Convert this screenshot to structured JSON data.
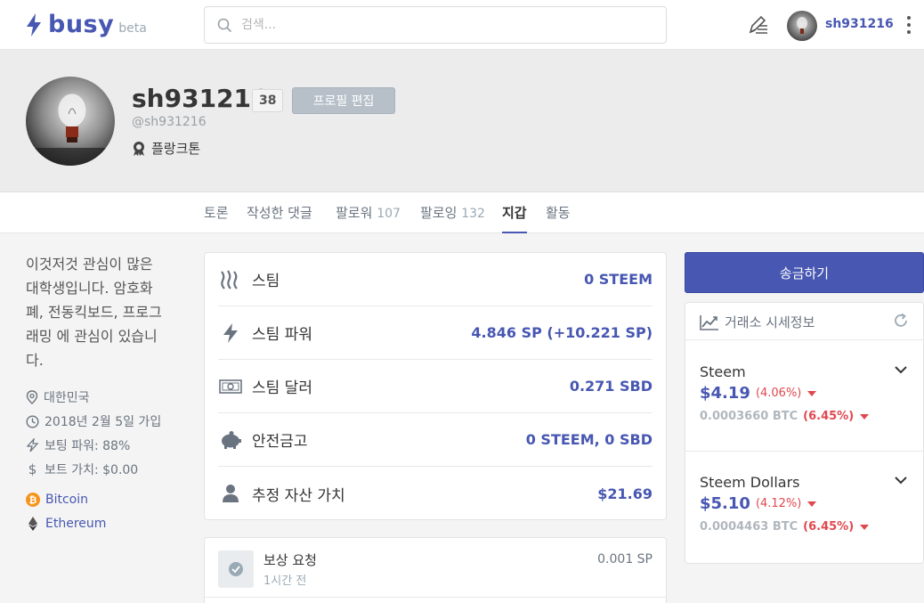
{
  "nav": {
    "logo": "busy",
    "beta": "beta",
    "search_placeholder": "검색...",
    "username": "sh931216"
  },
  "profile": {
    "name": "sh931216",
    "reputation": "38",
    "edit_label": "프로필 편집",
    "handle": "@sh931216",
    "rank": "플랑크톤"
  },
  "tabs": [
    {
      "label": "토론",
      "count": ""
    },
    {
      "label": "작성한 댓글",
      "count": ""
    },
    {
      "label": "팔로워",
      "count": "107"
    },
    {
      "label": "팔로잉",
      "count": "132"
    },
    {
      "label": "지갑",
      "count": ""
    },
    {
      "label": "활동",
      "count": ""
    }
  ],
  "sidebar": {
    "about_lines": [
      "이것저것 관심이 많은",
      "대학생입니다. 암호화",
      "폐, 전동킥보드, 프로그",
      "래밍 에 관심이 있습니",
      "다."
    ],
    "location": "대한민국",
    "joined": "2018년 2월 5일 가입",
    "voting_power": "보팅 파워: 88%",
    "vote_value": "보트 가치: $0.00",
    "coins": [
      "Bitcoin",
      "Ethereum"
    ]
  },
  "wallet": [
    {
      "icon": "steem-icon",
      "label": "스팀",
      "value": "0 STEEM"
    },
    {
      "icon": "bolt-icon",
      "label": "스팀 파워",
      "value": "4.846 SP (+10.221 SP)"
    },
    {
      "icon": "dollar-bill-icon",
      "label": "스팀 달러",
      "value": "0.271 SBD"
    },
    {
      "icon": "piggy-bank-icon",
      "label": "안전금고",
      "value": "0 STEEM, 0 SBD"
    },
    {
      "icon": "user-icon",
      "label": "추정 자산 가치",
      "value": "$21.69"
    }
  ],
  "activity": {
    "title": "보상 요청",
    "time": "1시간 전",
    "amount": "0.001 SP"
  },
  "right": {
    "transfer_label": "송금하기",
    "market_title": "거래소 시세정보",
    "coins": [
      {
        "name": "Steem",
        "usd": "$4.19",
        "usd_change": "(4.06%)",
        "btc": "0.0003660 BTC",
        "btc_change": "(6.45%)"
      },
      {
        "name": "Steem Dollars",
        "usd": "$5.10",
        "usd_change": "(4.12%)",
        "btc": "0.0004463 BTC",
        "btc_change": "(6.45%)"
      }
    ]
  },
  "colors": {
    "brand": "#4757b2",
    "negative": "#e0484e",
    "bitcoin": "#f7931a"
  }
}
